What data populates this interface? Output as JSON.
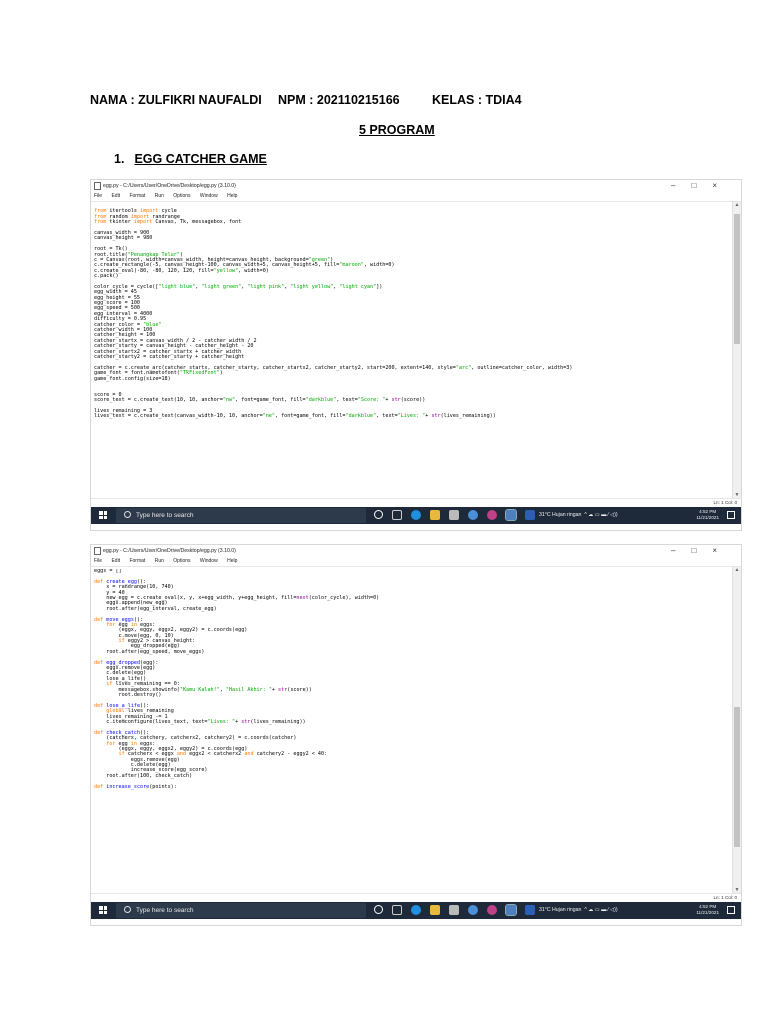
{
  "header": {
    "nama": "NAMA : ZULFIKRI NAUFALDI",
    "npm": "NPM : 202110215166",
    "kelas": "KELAS : TDIA4"
  },
  "doc_title": "5 PROGRAM",
  "section": {
    "number": "1.",
    "title": "EGG CATCHER GAME"
  },
  "window": {
    "title": "egg.py - C:/Users/User/OneDrive/Desktop/egg.py (3.10.0)",
    "controls": [
      "–",
      "□",
      "×"
    ],
    "menu": [
      "File",
      "Edit",
      "Format",
      "Run",
      "Options",
      "Window",
      "Help"
    ],
    "status": "Ln: 1   Col: 0"
  },
  "taskbar": {
    "search_placeholder": "Type here to search",
    "weather": "31°C  Hujan ringan",
    "time": "4:52 PM",
    "date": "11/21/2021"
  },
  "code1": [
    "",
    "from itertools import cycle",
    "from random import randrange",
    "from tkinter import Canvas, Tk, messagebox, font",
    "",
    "canvas_width = 900",
    "canvas_height = 980",
    "",
    "root = Tk()",
    "root.title(\"Penangkap Telur\")",
    "c = Canvas(root, width=canvas_width, height=canvas_height, background=\"green\")",
    "c.create_rectangle(-5, canvas_height-100, canvas_width+5, canvas_height+5, fill=\"maroon\", width=0)",
    "c.create_oval(-80, -80, 120, 120, fill=\"yellow\", width=0)",
    "c.pack()",
    "",
    "color_cycle = cycle([\"light blue\", \"light green\", \"light pink\", \"light yellow\", \"light cyan\"])",
    "egg_width = 45",
    "egg_height = 55",
    "egg_score = 100",
    "egg_speed = 500",
    "egg_interval = 4000",
    "difficulty = 0.95",
    "catcher_color = \"blue\"",
    "catcher_width = 100",
    "catcher_height = 100",
    "catcher_startx = canvas_width / 2 - catcher_width / 2",
    "catcher_starty = canvas_height - catcher_height - 20",
    "catcher_startx2 = catcher_startx + catcher_width",
    "catcher_starty2 = catcher_starty + catcher_height",
    "",
    "catcher = c.create_arc(catcher_startx, catcher_starty, catcher_startx2, catcher_starty2, start=200, extent=140, style=\"arc\", outline=catcher_color, width=3)",
    "game_font = font.nametofont(\"TkFixedFont\")",
    "game_font.config(size=18)",
    "",
    "",
    "score = 0",
    "score_text = c.create_text(10, 10, anchor=\"nw\", font=game_font, fill=\"darkblue\", text=\"Score: \"+ str(score))",
    "",
    "lives_remaining = 3",
    "lives_text = c.create_text(canvas_width-10, 10, anchor=\"ne\", font=game_font, fill=\"darkblue\", text=\"Lives: \"+ str(lives_remaining))"
  ],
  "code2": [
    "eggs = []",
    "",
    "def create_egg():",
    "    x = randrange(10, 740)",
    "    y = 40",
    "    new_egg = c.create_oval(x, y, x+egg_width, y+egg_height, fill=next(color_cycle), width=0)",
    "    eggs.append(new_egg)",
    "    root.after(egg_interval, create_egg)",
    "",
    "def move_eggs():",
    "    for egg in eggs:",
    "        (eggx, eggy, eggx2, eggy2) = c.coords(egg)",
    "        c.move(egg, 0, 10)",
    "        if eggy2 > canvas_height:",
    "            egg_dropped(egg)",
    "    root.after(egg_speed, move_eggs)",
    "",
    "def egg_dropped(egg):",
    "    eggs.remove(egg)",
    "    c.delete(egg)",
    "    lose_a_life()",
    "    if lives_remaining == 0:",
    "        messagebox.showinfo(\"Kamu Kalah!\", \"Hasil Akhir: \"+ str(score))",
    "        root.destroy()",
    "",
    "def lose_a_life():",
    "    global lives_remaining",
    "    lives_remaining -= 1",
    "    c.itemconfigure(lives_text, text=\"Lives: \"+ str(lives_remaining))",
    "",
    "def check_catch():",
    "    (catcherx, catchery, catcherx2, catchery2) = c.coords(catcher)",
    "    for egg in eggs:",
    "        (eggx, eggy, eggx2, eggy2) = c.coords(egg)",
    "        if catcherx < eggx and eggx2 < catcherx2 and catchery2 - eggy2 < 40:",
    "            eggs.remove(egg)",
    "            c.delete(egg)",
    "            increase_score(egg_score)",
    "    root.after(100, check_catch)",
    "",
    "def increase_score(points):"
  ]
}
